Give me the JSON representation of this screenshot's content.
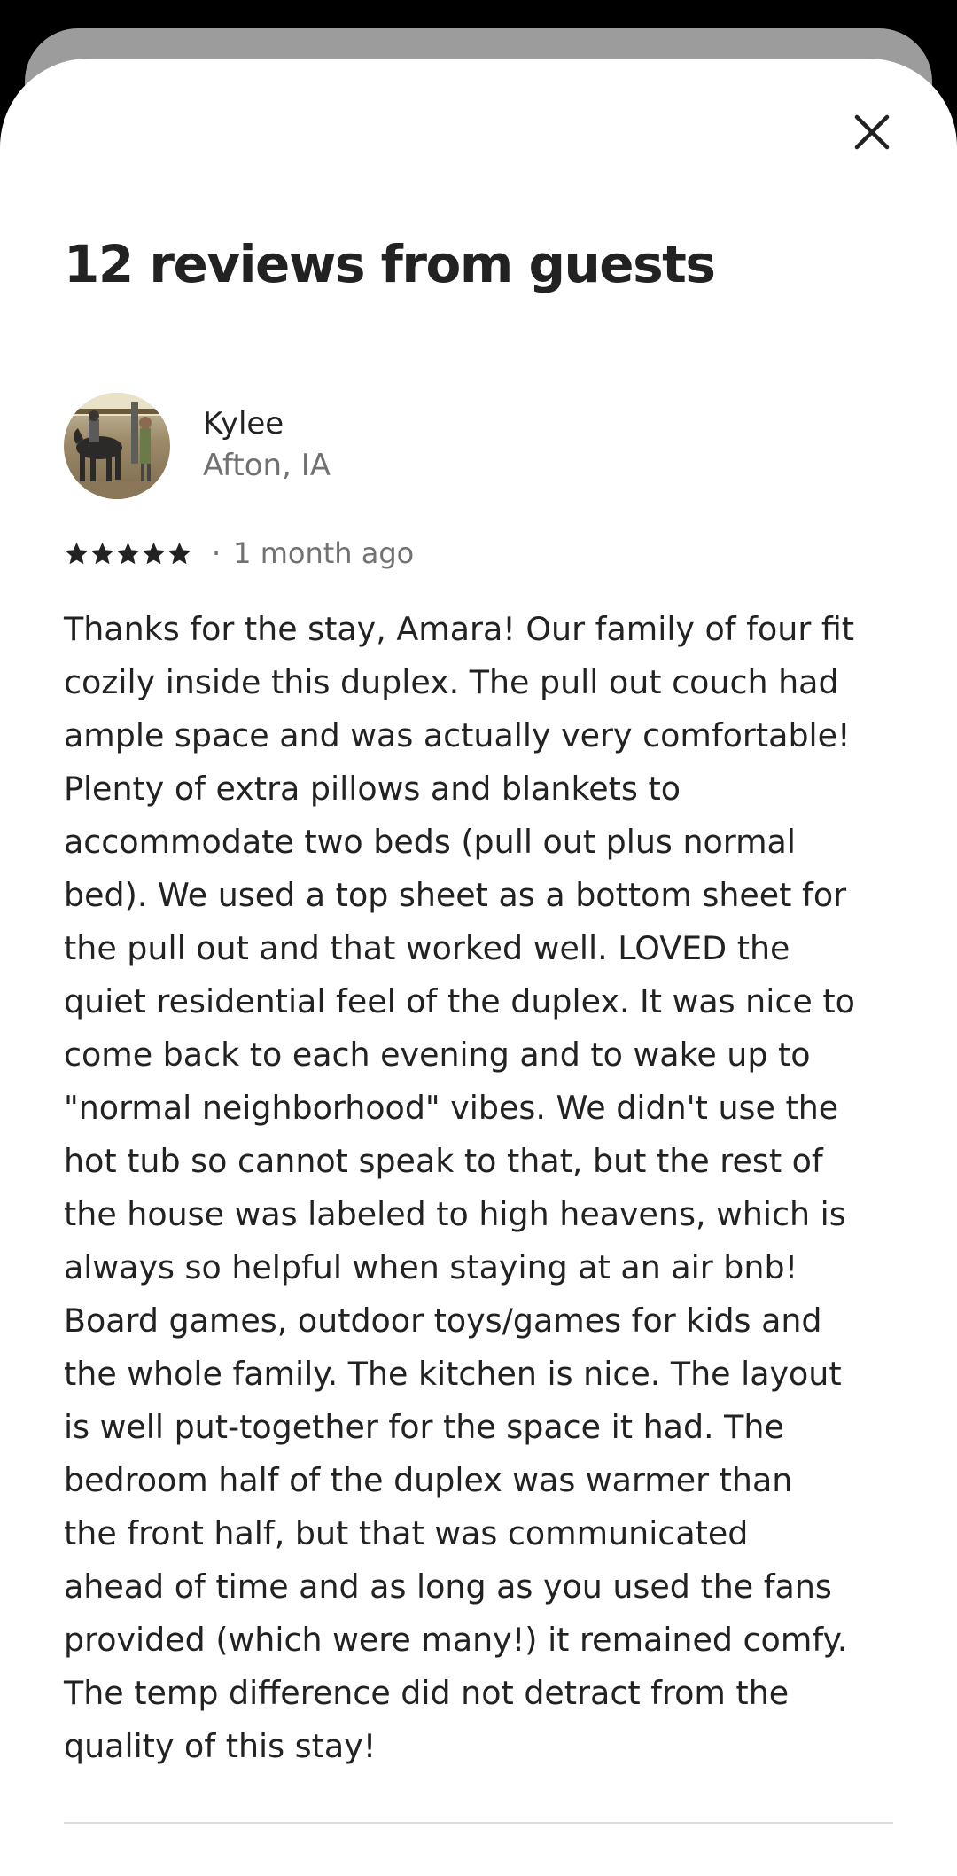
{
  "modal": {
    "title": "12 reviews from guests",
    "close_icon": "close-icon"
  },
  "review": {
    "avatar_icon": "avatar",
    "reviewer_name": "Kylee",
    "reviewer_location": "Afton, IA",
    "rating": 5,
    "rating_max": 5,
    "separator": "·",
    "date": "1 month ago",
    "text_lines": [
      "Thanks for the stay, Amara! Our family of four fit",
      "cozily inside this duplex. The pull out couch had",
      "ample space and was actually very comfortable!",
      "Plenty of extra pillows and blankets to",
      "accommodate two beds (pull out plus normal",
      "bed). We used a top sheet as a bottom sheet for",
      "the pull out and that worked well. LOVED the",
      "quiet residential feel of the duplex. It was nice to",
      "come back to each evening and to wake up to",
      "\"normal neighborhood\" vibes. We didn't use the",
      "hot tub so cannot speak to that, but the rest of",
      "the house was labeled to high heavens, which is",
      "always so helpful when staying at an air bnb!",
      "Board games, outdoor toys/games for kids and",
      "the whole family. The kitchen is nice. The layout",
      "is well put-together for the space it had. The",
      "bedroom half of the duplex was warmer than",
      "the front half, but that was communicated",
      "ahead of time and as long as you used the fans",
      "provided (which were many!) it remained comfy.",
      "The temp difference did not detract from the",
      "quality of this stay!"
    ]
  },
  "colors": {
    "text_primary": "#222222",
    "text_secondary": "#717171",
    "divider": "#dddddd",
    "backdrop": "#000000",
    "back_sheet": "#9c9c9c"
  }
}
